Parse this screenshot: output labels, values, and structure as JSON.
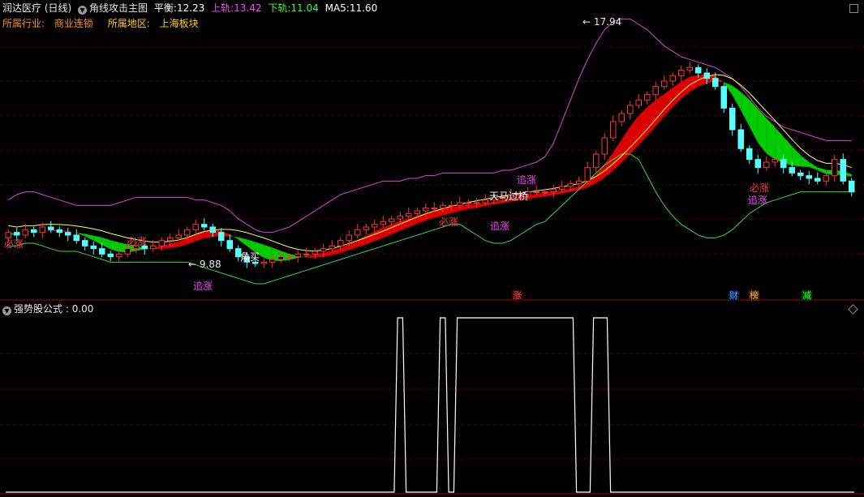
{
  "header": {
    "stock_name": "润达医疗",
    "period": "(日线)",
    "indicator_name": "角线攻击主图",
    "balance_label": "平衡:",
    "balance_value": "12.23",
    "upper_label": "上轨:",
    "upper_value": "13.42",
    "lower_label": "下轨:",
    "lower_value": "11.04",
    "ma5_label": "MA5:",
    "ma5_value": "11.60",
    "industry_label": "所属行业:",
    "industry_value": "商业连锁",
    "region_label": "所属地区:",
    "region_value": "上海板块"
  },
  "sub_panel": {
    "formula_name": "强势股公式",
    "value": ": 0.00"
  },
  "annotations": {
    "high_price": "17.94",
    "low_price": "9.88",
    "signals": [
      {
        "text": "必涨",
        "color": "#ff3b3b"
      },
      {
        "text": "必涨",
        "color": "#ff3b3b"
      },
      {
        "text": "追涨",
        "color": "#ff40ff"
      },
      {
        "text": "角买",
        "color": "#ffffff"
      },
      {
        "text": "必涨",
        "color": "#ff3b3b"
      },
      {
        "text": "追涨",
        "color": "#ff40ff"
      },
      {
        "text": "天马过桥",
        "color": "#ffffff"
      },
      {
        "text": "追涨",
        "color": "#ff40ff"
      },
      {
        "text": "追涨",
        "color": "#ff40ff"
      },
      {
        "text": "必涨",
        "color": "#ff3b3b"
      }
    ],
    "badges": [
      {
        "text": "涨",
        "color": "#ff4d4d"
      },
      {
        "text": "财",
        "color": "#4da6ff"
      },
      {
        "text": "榜",
        "color": "#ffaa33"
      },
      {
        "text": "减",
        "color": "#33ff33"
      }
    ]
  },
  "colors": {
    "background": "#000000",
    "up_candle": "#ff3333",
    "down_candle": "#55ffff",
    "upper_band": "#e040e0",
    "lower_band": "#33dd33",
    "ma_line": "#ffff55",
    "bull_fill": "#dd0000",
    "bear_fill": "#00cc00",
    "grid": "#990000",
    "label_orange": "#ff8c1a",
    "label_yellow": "#ffcc00"
  },
  "chart_data": [
    {
      "type": "candlestick",
      "title": "角线攻击主图",
      "days": 100,
      "open": [
        10.9,
        11.1,
        11.0,
        11.2,
        11.1,
        11.3,
        11.2,
        11.1,
        11.0,
        10.8,
        10.6,
        10.5,
        10.3,
        10.2,
        10.3,
        10.5,
        10.6,
        10.5,
        10.6,
        10.8,
        10.9,
        11.0,
        11.2,
        11.4,
        11.3,
        11.1,
        10.8,
        10.5,
        10.2,
        10.0,
        9.95,
        10.0,
        10.1,
        10.2,
        10.2,
        10.3,
        10.3,
        10.4,
        10.5,
        10.6,
        10.8,
        11.0,
        11.2,
        11.3,
        11.4,
        11.5,
        11.6,
        11.7,
        11.8,
        11.9,
        12.0,
        12.0,
        12.1,
        12.1,
        12.2,
        12.2,
        12.2,
        12.3,
        12.4,
        12.4,
        12.5,
        12.5,
        12.6,
        12.6,
        12.6,
        12.7,
        12.8,
        12.9,
        13.0,
        13.5,
        14.0,
        14.6,
        15.2,
        15.5,
        15.8,
        16.0,
        16.2,
        16.5,
        16.7,
        16.9,
        17.1,
        17.2,
        17.0,
        16.8,
        16.5,
        15.7,
        14.9,
        14.2,
        13.8,
        13.5,
        13.7,
        13.8,
        13.5,
        13.3,
        13.2,
        13.1,
        13.0,
        13.2,
        13.8,
        13.0
      ],
      "close": [
        11.1,
        11.0,
        11.2,
        11.1,
        11.3,
        11.2,
        11.1,
        11.0,
        10.8,
        10.6,
        10.5,
        10.3,
        10.2,
        10.3,
        10.5,
        10.6,
        10.5,
        10.6,
        10.8,
        10.9,
        11.0,
        11.2,
        11.4,
        11.3,
        11.1,
        10.8,
        10.5,
        10.2,
        10.0,
        9.95,
        10.0,
        10.1,
        10.2,
        10.2,
        10.3,
        10.3,
        10.4,
        10.5,
        10.6,
        10.8,
        11.0,
        11.2,
        11.3,
        11.4,
        11.5,
        11.6,
        11.7,
        11.8,
        11.9,
        12.0,
        12.0,
        12.1,
        12.1,
        12.2,
        12.2,
        12.2,
        12.3,
        12.4,
        12.4,
        12.5,
        12.5,
        12.6,
        12.6,
        12.6,
        12.7,
        12.8,
        12.9,
        13.0,
        13.5,
        14.0,
        14.6,
        15.2,
        15.5,
        15.8,
        16.0,
        16.2,
        16.5,
        16.7,
        16.9,
        17.1,
        17.2,
        17.0,
        16.8,
        16.5,
        15.7,
        14.9,
        14.2,
        13.8,
        13.5,
        13.7,
        13.8,
        13.5,
        13.3,
        13.2,
        13.1,
        13.0,
        13.2,
        13.8,
        13.0,
        12.6
      ],
      "ma5": [
        11.0,
        11.05,
        11.1,
        11.12,
        11.14,
        11.18,
        11.18,
        11.16,
        11.08,
        10.96,
        10.8,
        10.64,
        10.48,
        10.38,
        10.36,
        10.42,
        10.48,
        10.52,
        10.6,
        10.68,
        10.76,
        10.9,
        11.06,
        11.16,
        11.2,
        11.16,
        11.02,
        10.84,
        10.6,
        10.36,
        10.16,
        10.06,
        10.04,
        10.08,
        10.16,
        10.22,
        10.28,
        10.34,
        10.42,
        10.52,
        10.66,
        10.82,
        10.98,
        11.14,
        11.28,
        11.4,
        11.52,
        11.62,
        11.72,
        11.82,
        11.9,
        11.98,
        12.04,
        12.08,
        12.12,
        12.14,
        12.18,
        12.24,
        12.3,
        12.36,
        12.42,
        12.46,
        12.52,
        12.56,
        12.6,
        12.66,
        12.72,
        12.8,
        12.98,
        13.24,
        13.62,
        14.06,
        14.54,
        15.02,
        15.42,
        15.74,
        16.0,
        16.22,
        16.46,
        16.68,
        16.86,
        16.92,
        16.96,
        16.9,
        16.64,
        16.18,
        15.62,
        15.02,
        14.42,
        14.02,
        13.8,
        13.66,
        13.58,
        13.54,
        13.52,
        13.4,
        13.26,
        13.22,
        13.24,
        13.16
      ],
      "upper_band": [
        12.3,
        12.5,
        12.6,
        12.6,
        12.5,
        12.4,
        12.3,
        12.2,
        12.1,
        12.1,
        12.1,
        12.1,
        12.1,
        12.2,
        12.3,
        12.4,
        12.4,
        12.4,
        12.4,
        12.4,
        12.4,
        12.4,
        12.3,
        12.3,
        12.2,
        12.1,
        11.9,
        11.6,
        11.4,
        11.2,
        11.1,
        11.1,
        11.2,
        11.3,
        11.5,
        11.7,
        11.9,
        12.1,
        12.3,
        12.5,
        12.6,
        12.7,
        12.8,
        12.9,
        13.0,
        13.0,
        13.0,
        13.1,
        13.1,
        13.2,
        13.2,
        13.3,
        13.3,
        13.3,
        13.3,
        13.3,
        13.3,
        13.3,
        13.4,
        13.4,
        13.5,
        13.6,
        13.7,
        13.9,
        14.4,
        15.2,
        16.0,
        16.8,
        17.5,
        18.1,
        18.6,
        18.9,
        19.0,
        19.0,
        18.8,
        18.6,
        18.3,
        18.0,
        17.8,
        17.6,
        17.5,
        17.4,
        17.3,
        17.2,
        17.0,
        16.8,
        16.5,
        16.1,
        15.7,
        15.4,
        15.2,
        15.0,
        14.9,
        14.8,
        14.7,
        14.6,
        14.5,
        14.5,
        14.5,
        14.5
      ],
      "lower_band": [
        10.6,
        10.6,
        10.7,
        10.7,
        10.6,
        10.5,
        10.4,
        10.4,
        10.4,
        10.3,
        10.2,
        10.1,
        10.0,
        10.0,
        10.0,
        10.0,
        10.0,
        10.0,
        10.0,
        10.0,
        10.0,
        10.0,
        9.9,
        9.8,
        9.7,
        9.6,
        9.5,
        9.4,
        9.3,
        9.2,
        9.2,
        9.3,
        9.4,
        9.5,
        9.6,
        9.7,
        9.8,
        9.9,
        10.0,
        10.1,
        10.2,
        10.3,
        10.4,
        10.5,
        10.6,
        10.7,
        10.8,
        10.9,
        11.0,
        11.1,
        11.2,
        11.3,
        11.4,
        11.4,
        11.2,
        11.0,
        10.8,
        10.7,
        10.7,
        10.8,
        11.0,
        11.2,
        11.4,
        11.5,
        11.8,
        12.1,
        12.4,
        12.7,
        13.0,
        13.3,
        13.6,
        13.8,
        14.0,
        14.0,
        13.8,
        13.2,
        12.6,
        12.1,
        11.7,
        11.4,
        11.2,
        11.0,
        10.9,
        10.9,
        11.0,
        11.2,
        11.5,
        11.8,
        12.0,
        12.2,
        12.3,
        12.4,
        12.5,
        12.6,
        12.6,
        12.6,
        12.6,
        12.6,
        12.6,
        12.6
      ],
      "ylim": [
        9.2,
        18.8
      ]
    },
    {
      "type": "line",
      "title": "强势股公式",
      "x": [
        0,
        1,
        2,
        3,
        4,
        5,
        6,
        7,
        8,
        9,
        10,
        11,
        12,
        13,
        14,
        15,
        16,
        17,
        18,
        19,
        20,
        21,
        22,
        23,
        24,
        25,
        26,
        27,
        28,
        29,
        30,
        31,
        32,
        33,
        34,
        35,
        36,
        37,
        38,
        39,
        40,
        41,
        42,
        43,
        44,
        45,
        46,
        47,
        48,
        49,
        50,
        51,
        52,
        53,
        54,
        55,
        56,
        57,
        58,
        59,
        60,
        61,
        62,
        63,
        64,
        65,
        66,
        67,
        68,
        69,
        70,
        71,
        72,
        73,
        74,
        75,
        76,
        77,
        78,
        79,
        80,
        81,
        82,
        83,
        84,
        85,
        86,
        87,
        88,
        89,
        90,
        91,
        92,
        93,
        94,
        95,
        96,
        97,
        98,
        99
      ],
      "values": [
        0,
        0,
        0,
        0,
        0,
        0,
        0,
        0,
        0,
        0,
        0,
        0,
        0,
        0,
        0,
        0,
        0,
        0,
        0,
        0,
        0,
        0,
        0,
        0,
        0,
        0,
        0,
        0,
        0,
        0,
        0,
        0,
        0,
        0,
        0,
        0,
        0,
        0,
        0,
        0,
        0,
        0,
        0,
        0,
        0,
        0,
        1,
        0,
        0,
        0,
        0,
        1,
        0,
        1,
        1,
        1,
        1,
        1,
        1,
        1,
        1,
        1,
        1,
        1,
        1,
        1,
        1,
        0,
        0,
        1,
        1,
        0,
        0,
        0,
        0,
        0,
        0,
        0,
        0,
        0,
        0,
        0,
        0,
        0,
        0,
        0,
        0,
        0,
        0,
        0,
        0,
        0,
        0,
        0,
        0,
        0,
        0,
        0,
        0,
        0
      ],
      "ylim": [
        0,
        1
      ]
    }
  ]
}
